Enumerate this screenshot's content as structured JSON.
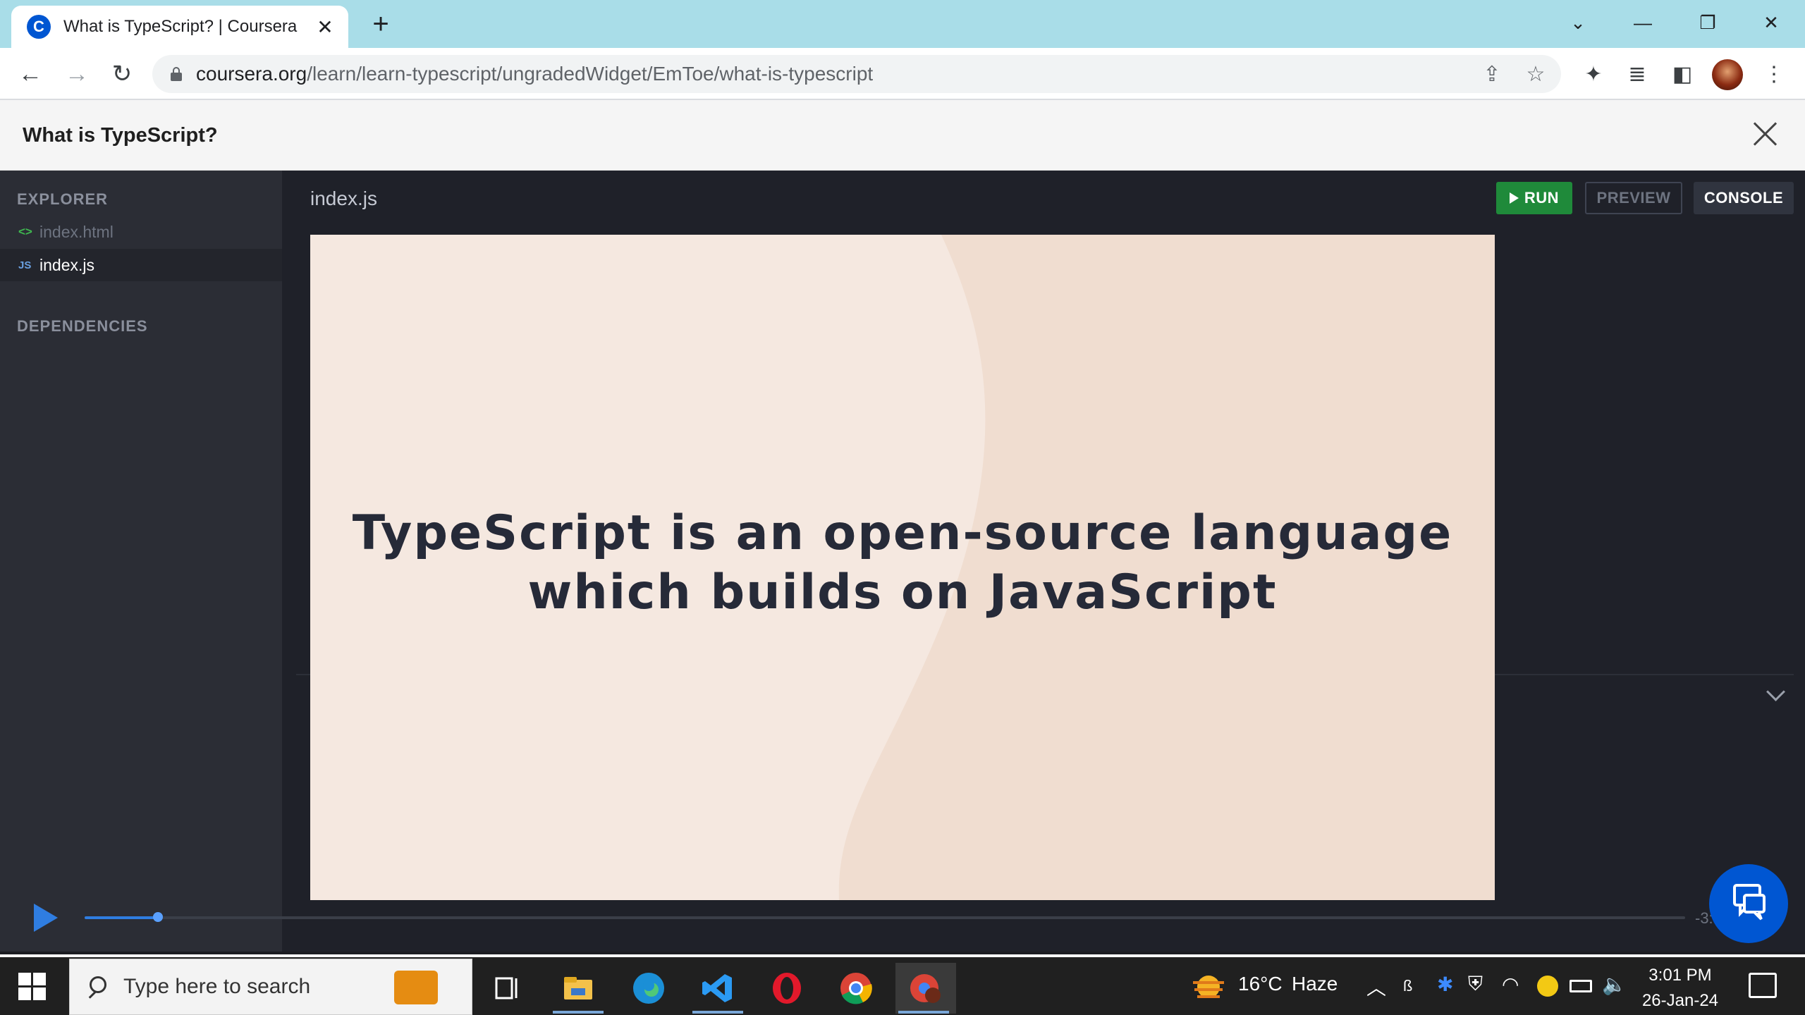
{
  "browser": {
    "tab_title": "What is TypeScript? | Coursera",
    "tab_favicon_letter": "C",
    "url_host": "coursera.org",
    "url_path": "/learn/learn-typescript/ungradedWidget/EmToe/what-is-typescript"
  },
  "modal": {
    "title": "What is TypeScript?"
  },
  "sidebar": {
    "explorer_label": "EXPLORER",
    "files": [
      {
        "icon": "<>",
        "name": "index.html"
      },
      {
        "icon": "JS",
        "name": "index.js"
      }
    ],
    "dependencies_label": "DEPENDENCIES"
  },
  "editor": {
    "filename": "index.js",
    "run_label": "RUN",
    "preview_label": "PREVIEW",
    "console_label": "CONSOLE"
  },
  "slide": {
    "line1": "TypeScript is an open-source language",
    "line2": "which builds on JavaScript"
  },
  "player": {
    "progress_fraction": 0.046,
    "time_remaining": "-3:"
  },
  "taskbar": {
    "search_placeholder": "Type here to search",
    "weather_temp": "16°C",
    "weather_desc": "Haze",
    "time": "3:01 PM",
    "date": "26-Jan-24"
  },
  "colors": {
    "accent": "#2f7de1",
    "run_green": "#1f8a3a",
    "slide_bg": "#f5e8e0"
  }
}
